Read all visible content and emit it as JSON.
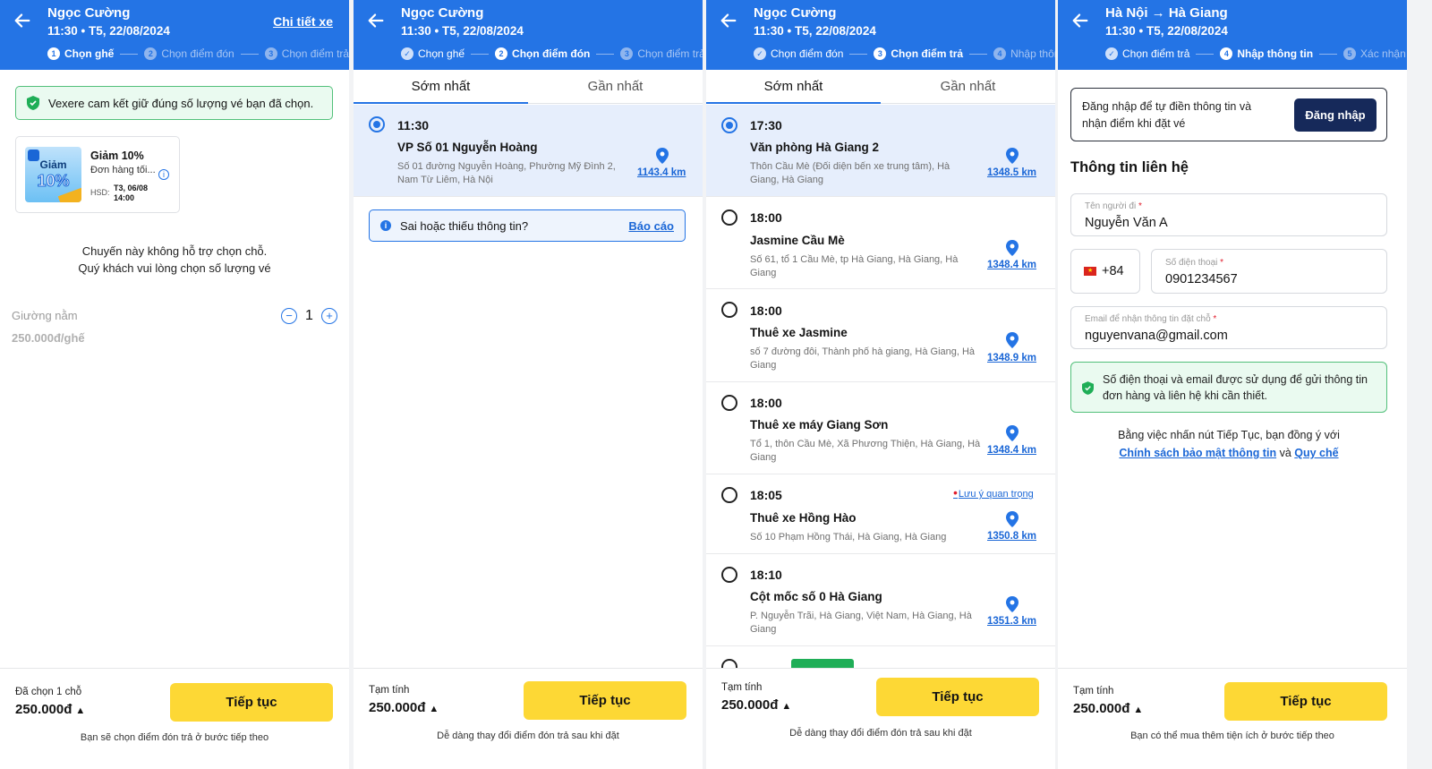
{
  "panel1": {
    "title": "Ngọc Cường",
    "subtitle": "11:30 • T5, 22/08/2024",
    "detail_link": "Chi tiết xe",
    "steps": [
      {
        "num": "1",
        "label": "Chọn ghế"
      },
      {
        "num": "2",
        "label": "Chọn điểm đón"
      },
      {
        "num": "3",
        "label": "Chọn điểm trả"
      }
    ],
    "commit_text": "Vexere cam kết giữ đúng số lượng vé bạn đã chọn.",
    "coupon": {
      "badge_top": "Giảm",
      "badge_value": "10%",
      "title": "Giảm 10%",
      "desc": "Đơn hàng tối...",
      "expiry_label": "HSD:",
      "expiry_day": "T3, 06/08",
      "expiry_time": "14:00"
    },
    "no_seat_line1": "Chuyến này không hỗ trợ chọn chỗ.",
    "no_seat_line2": "Quý khách vui lòng chọn số lượng vé",
    "seat_type": "Giường nằm",
    "seat_price": "250.000đ/ghế",
    "quantity": "1",
    "footer": {
      "label": "Đã chọn 1 chỗ",
      "price": "250.000đ",
      "cta": "Tiếp tục",
      "hint": "Bạn sẽ chọn điểm đón trả ở bước tiếp theo"
    }
  },
  "panel2": {
    "title": "Ngọc Cường",
    "subtitle": "11:30 • T5, 22/08/2024",
    "steps": [
      {
        "num": "",
        "label": "Chọn ghế"
      },
      {
        "num": "2",
        "label": "Chọn điểm đón"
      },
      {
        "num": "3",
        "label": "Chọn điểm trả"
      }
    ],
    "tabs": [
      "Sớm nhất",
      "Gần nhất"
    ],
    "point": {
      "time": "11:30",
      "name": "VP Số 01 Nguyễn Hoàng",
      "address": "Số 01 đường Nguyễn Hoàng, Phường Mỹ Đình 2, Nam Từ Liêm, Hà Nội",
      "distance": "1143.4 km"
    },
    "report_text": "Sai hoặc thiếu thông tin?",
    "report_link": "Báo cáo",
    "footer": {
      "label": "Tạm tính",
      "price": "250.000đ",
      "cta": "Tiếp tục",
      "hint": "Dễ dàng thay đổi điểm đón trả sau khi đặt"
    }
  },
  "panel3": {
    "title": "Ngọc Cường",
    "subtitle": "11:30 • T5, 22/08/2024",
    "steps": [
      {
        "num": "",
        "label": "Chọn điểm đón"
      },
      {
        "num": "3",
        "label": "Chọn điểm trả"
      },
      {
        "num": "4",
        "label": "Nhập thông"
      }
    ],
    "tabs": [
      "Sớm nhất",
      "Gần nhất"
    ],
    "points": [
      {
        "time": "17:30",
        "name": "Văn phòng Hà Giang 2",
        "address": "Thôn Cầu Mè (Đối diện bến xe trung tâm), Hà Giang, Hà Giang",
        "distance": "1348.5 km",
        "note": ""
      },
      {
        "time": "18:00",
        "name": "Jasmine Cầu Mè",
        "address": "Số 61, tổ 1 Cầu Mè, tp Hà Giang, Hà Giang, Hà Giang",
        "distance": "1348.4 km",
        "note": ""
      },
      {
        "time": "18:00",
        "name": "Thuê xe Jasmine",
        "address": "số 7 đường đôi, Thành phố hà giang, Hà Giang, Hà Giang",
        "distance": "1348.9 km",
        "note": ""
      },
      {
        "time": "18:00",
        "name": "Thuê xe máy Giang Sơn",
        "address": "Tổ 1, thôn Cầu Mè, Xã Phương Thiện, Hà Giang, Hà Giang",
        "distance": "1348.4 km",
        "note": ""
      },
      {
        "time": "18:05",
        "name": "Thuê xe Hồng Hào",
        "address": "Số 10 Phạm Hồng Thái, Hà Giang, Hà Giang",
        "distance": "1350.8 km",
        "note": "Lưu ý quan trọng"
      },
      {
        "time": "18:10",
        "name": "Cột mốc số 0 Hà Giang",
        "address": "P. Nguyễn Trãi, Hà Giang, Việt Nam, Hà Giang, Hà Giang",
        "distance": "1351.3 km",
        "note": ""
      }
    ],
    "footer": {
      "label": "Tạm tính",
      "price": "250.000đ",
      "cta": "Tiếp tục",
      "hint": "Dễ dàng thay đổi điểm đón trả sau khi đặt"
    }
  },
  "panel4": {
    "title": "Hà Nội → Hà Giang",
    "subtitle": "11:30 • T5, 22/08/2024",
    "steps": [
      {
        "num": "",
        "label": "Chọn điểm trả"
      },
      {
        "num": "4",
        "label": "Nhập thông tin"
      },
      {
        "num": "5",
        "label": "Xác nhận hàn"
      }
    ],
    "login_text": "Đăng nhập để tự điền thông tin và nhận điểm khi đặt vé",
    "login_button": "Đăng nhập",
    "section_title": "Thông tin liên hệ",
    "name_label": "Tên người đi",
    "name_value": "Nguyễn Văn A",
    "country_code": "+84",
    "phone_label": "Số điện thoại",
    "phone_value": "0901234567",
    "email_label": "Email để nhận thông tin đặt chỗ",
    "email_value": "nguyenvana@gmail.com",
    "notice": "Số điện thoại và email được sử dụng để gửi thông tin đơn hàng và liên hệ khi cần thiết.",
    "consent_prefix": "Bằng việc nhấn nút Tiếp Tục, bạn đồng ý với",
    "policy_link": "Chính sách bảo mật thông tin",
    "consent_and": "và",
    "rules_link": "Quy chế",
    "footer": {
      "label": "Tạm tính",
      "price": "250.000đ",
      "cta": "Tiếp tục",
      "hint": "Bạn có thể mua thêm tiện ích ở bước tiếp theo"
    }
  },
  "colors": {
    "header": "#2474e5",
    "cta": "#fdd835",
    "link": "#1a66d6",
    "success_bg": "#eafaf0",
    "success_border": "#52c07a"
  }
}
